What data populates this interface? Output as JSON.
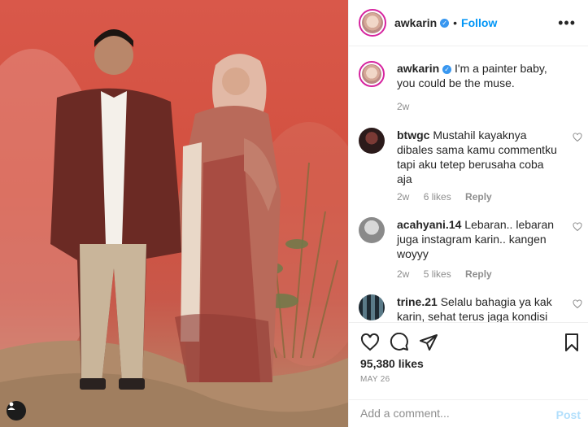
{
  "post": {
    "username": "awkarin",
    "follow_label": "Follow",
    "more_label": "•••",
    "likes": "95,380 likes",
    "date": "MAY 26"
  },
  "caption": {
    "username": "awkarin",
    "text": "I'm a painter baby, you could be the muse.",
    "time": "2w"
  },
  "comments": [
    {
      "username": "btwgc",
      "text": "Mustahil kayaknya dibales sama kamu commentku tapi aku tetep berusaha coba aja",
      "time": "2w",
      "likes": "6 likes",
      "reply": "Reply"
    },
    {
      "username": "acahyani.14",
      "text": "Lebaran.. lebaran juga instagram karin.. kangen woyyy",
      "time": "2w",
      "likes": "5 likes",
      "reply": "Reply"
    },
    {
      "username": "trine.21",
      "text": "Selalu bahagia ya kak karin, sehat terus jaga kondisi",
      "time": "",
      "likes": "",
      "reply": ""
    }
  ],
  "add_comment": {
    "placeholder": "Add a comment...",
    "post_label": "Post"
  },
  "icons": {
    "like": "heart-icon",
    "comment": "comment-icon",
    "share": "share-icon",
    "save": "bookmark-icon",
    "tag": "user-tag-icon",
    "verified": "verified-badge-icon"
  },
  "colors": {
    "accent": "#0095f6",
    "post_disabled": "#b2dffc",
    "photo_background": "#d2503f"
  }
}
